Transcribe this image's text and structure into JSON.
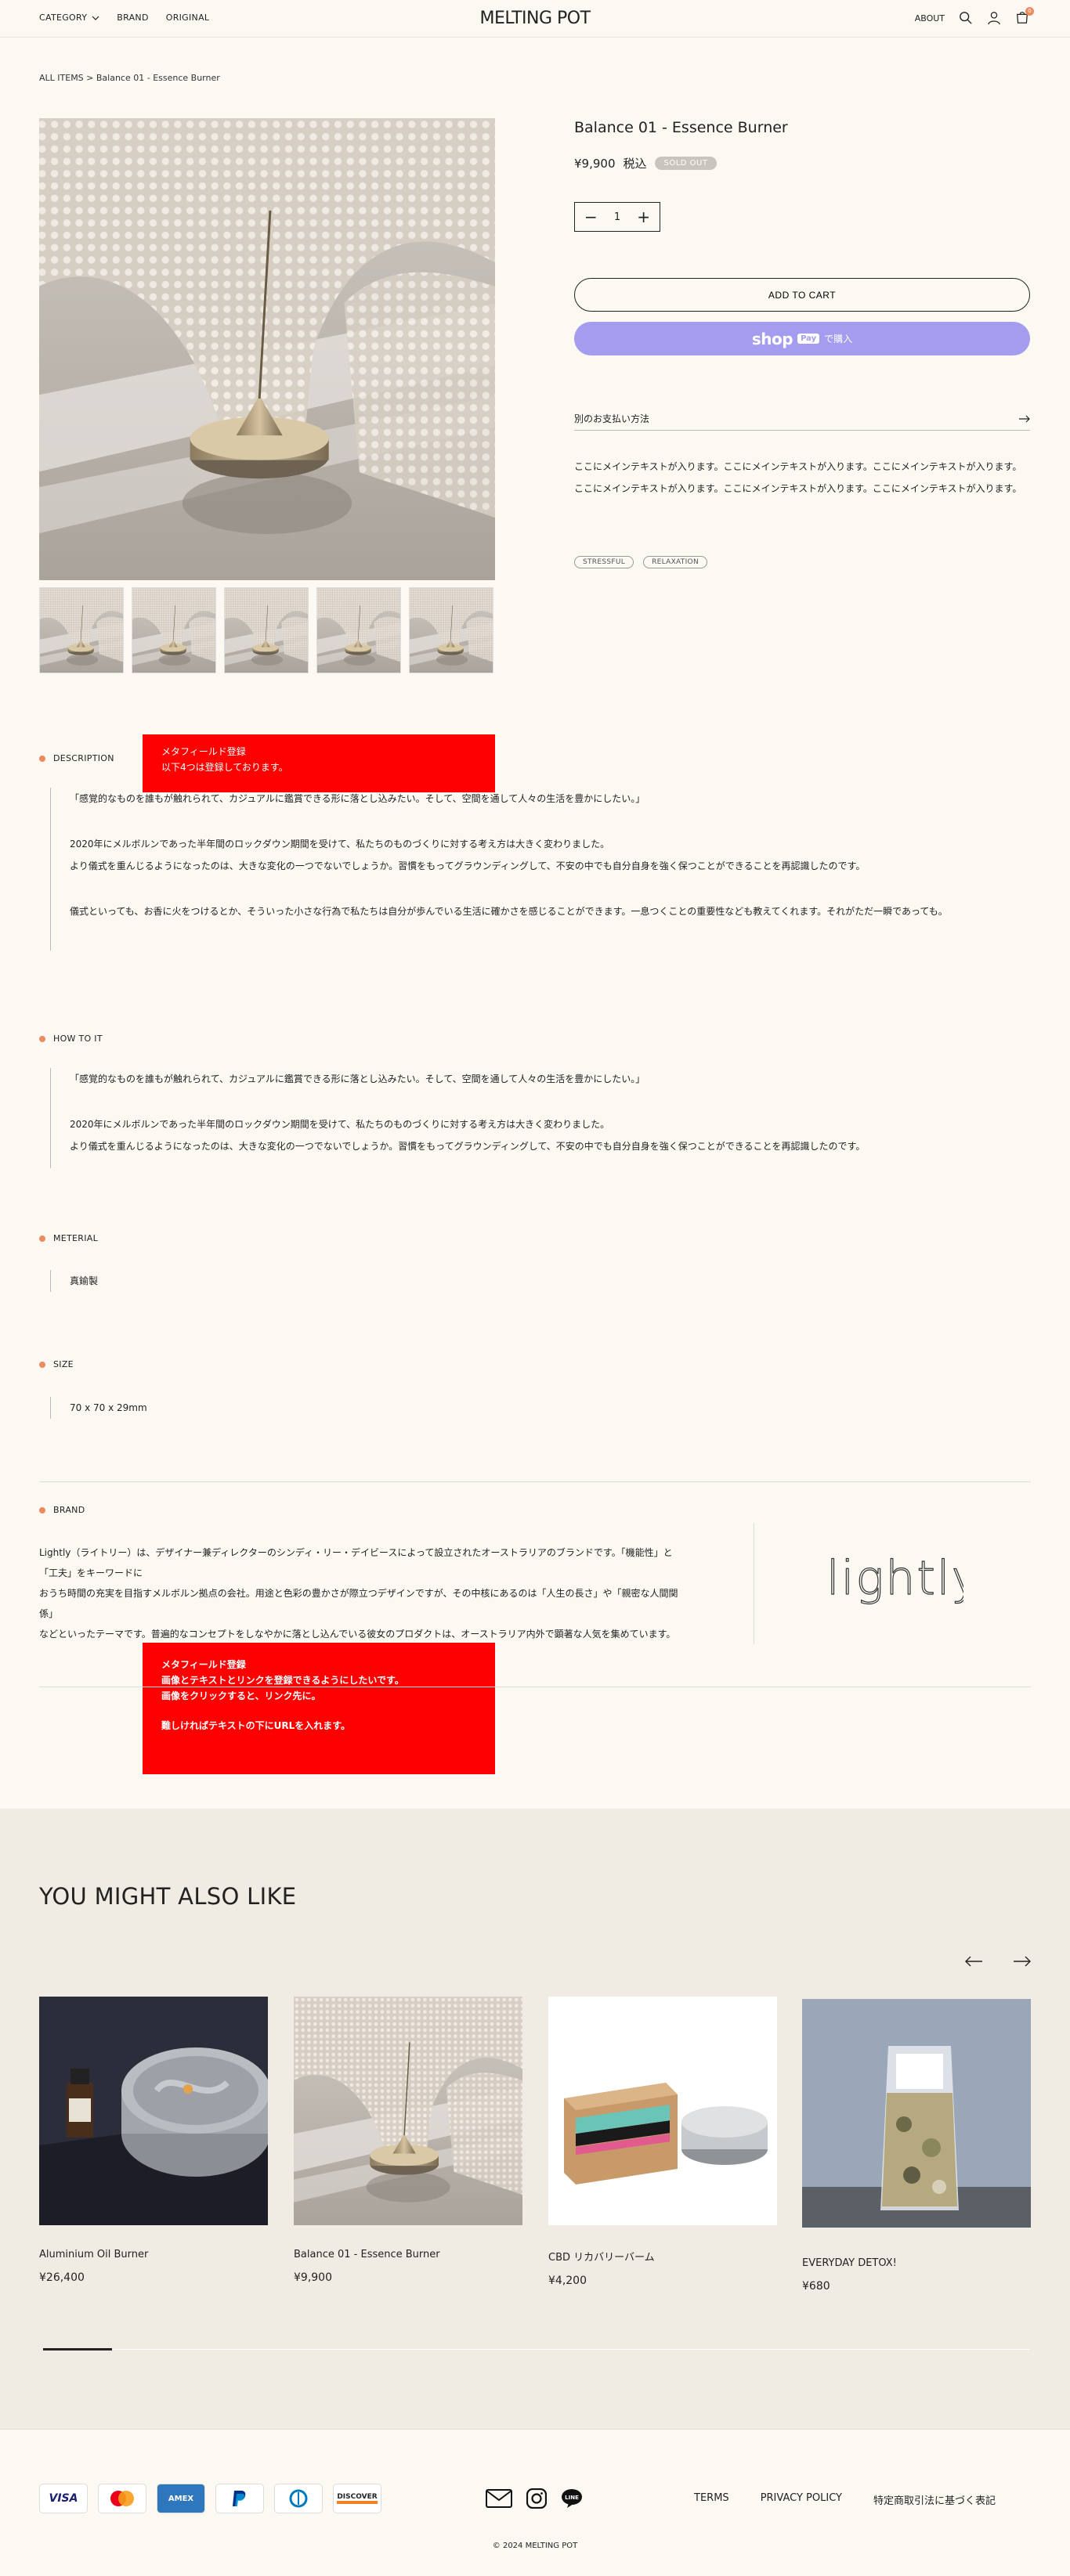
{
  "header": {
    "nav": [
      "CATEGORY",
      "BRAND",
      "ORIGINAL"
    ],
    "logo": "MELTING POT",
    "about": "ABOUT",
    "cart_count": "0"
  },
  "breadcrumb": "ALL ITEMS > Balance 01 - Essence Burner",
  "product": {
    "title": "Balance 01 - Essence Burner",
    "price": "¥9,900",
    "tax": "税込",
    "sold_out": "SOLD OUT",
    "qty": "1",
    "add_to_cart": "ADD TO CART",
    "shop_pay_brand": "shop",
    "shop_pay_pay": "Pay",
    "shop_pay_suffix": "で購入",
    "other_payment": "別のお支払い方法",
    "description": "ここにメインテキストが入ります。ここにメインテキストが入ります。ここにメインテキストが入ります。ここにメインテキストが入ります。ここにメインテキストが入ります。ここにメインテキストが入ります。",
    "tags": [
      "STRESSFUL",
      "RELAXATION"
    ]
  },
  "sections": {
    "description": {
      "label": "DESCRIPTION",
      "quote": "「感覚的なものを誰もが触れられて、カジュアルに鑑賞できる形に落とし込みたい。そして、空間を通して人々の生活を豊かにしたい。」",
      "p1": "2020年にメルボルンであった半年間のロックダウン期間を受けて、私たちのものづくりに対する考え方は大きく変わりました。",
      "p2": "より儀式を重んじるようになったのは、大きな変化の一つでないでしょうか。習慣をもってグラウンディングして、不安の中でも自分自身を強く保つことができることを再認識したのです。",
      "p3": "儀式といっても、お香に火をつけるとか、そういった小さな行為で私たちは自分が歩んでいる生活に確かさを感じることができます。一息つくことの重要性なども教えてくれます。それがただ一瞬であっても。"
    },
    "note1": {
      "l1": "メタフィールド登録",
      "l2": "以下4つは登録しております。"
    },
    "howto": {
      "label": "HOW TO IT",
      "quote": "「感覚的なものを誰もが触れられて、カジュアルに鑑賞できる形に落とし込みたい。そして、空間を通して人々の生活を豊かにしたい。」",
      "p1": "2020年にメルボルンであった半年間のロックダウン期間を受けて、私たちのものづくりに対する考え方は大きく変わりました。",
      "p2": "より儀式を重んじるようになったのは、大きな変化の一つでないでしょうか。習慣をもってグラウンディングして、不安の中でも自分自身を強く保つことができることを再認識したのです。"
    },
    "material": {
      "label": "METERIAL",
      "value": "真鍮製"
    },
    "size": {
      "label": "SIZE",
      "value": "70 x 70 x 29mm"
    },
    "brand": {
      "label": "BRAND",
      "l1": "Lightly（ライトリー）は、デザイナー兼ディレクターのシンディ・リー・デイビースによって設立されたオーストラリアのブランドです。「機能性」と「工夫」をキーワードに",
      "l2": "おうち時間の充実を目指すメルボルン拠点の会社。用途と色彩の豊かさが際立つデザインですが、その中核にあるのは「人生の長さ」や「親密な人間関係」",
      "l3": "などといったテーマです。普遍的なコンセプトをしなやかに落とし込んでいる彼女のプロダクトは、オーストラリア内外で顕著な人気を集めています。",
      "logo": "lightly"
    },
    "note2": {
      "l1": "メタフィールド登録",
      "l2": "画像とテキストとリンクを登録できるようにしたいです。",
      "l3": "画像をクリックすると、リンク先に。",
      "l4": "難しければテキストの下にURLを入れます。"
    }
  },
  "recommend": {
    "title": "YOU MIGHT ALSO LIKE",
    "items": [
      {
        "name": "Aluminium Oil Burner",
        "price": "¥26,400"
      },
      {
        "name": "Balance 01 - Essence Burner",
        "price": "¥9,900"
      },
      {
        "name": "CBD リカバリーバーム",
        "price": "¥4,200"
      },
      {
        "name": "EVERYDAY DETOX!",
        "price": "¥680"
      }
    ],
    "scroll_progress": 0.07
  },
  "footer": {
    "payments": [
      "VISA",
      "Mastercard",
      "AMEX",
      "PayPal",
      "Diners",
      "DISCOVER"
    ],
    "socials": [
      "mail-icon",
      "instagram-icon",
      "line-icon"
    ],
    "line_label": "LINE",
    "links": [
      "TERMS",
      "PRIVACY POLICY",
      "特定商取引法に基づく表記"
    ],
    "copyright": "© 2024 MELTING POT"
  },
  "colors": {
    "background": "#fcf8f2",
    "accent_dot": "#ec8a60",
    "shop_pay": "#a49cee",
    "note_red": "#ff0000"
  }
}
